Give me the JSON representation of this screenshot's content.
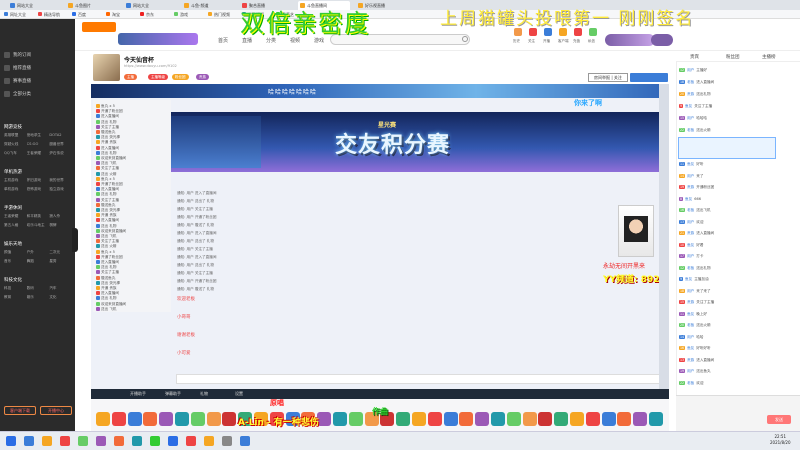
{
  "browser": {
    "tabs": [
      {
        "label": "网站大全",
        "color": "#3b7dd8"
      },
      {
        "label": "斗鱼图片",
        "color": "#f5a623"
      },
      {
        "label": "网站大全",
        "color": "#3b7dd8"
      },
      {
        "label": "斗鱼-频道",
        "color": "#f5a623"
      },
      {
        "label": "聚合直播",
        "color": "#e44"
      },
      {
        "label": "斗鱼直播间",
        "color": "#f5a623"
      },
      {
        "label": "好乐视直播",
        "color": "#f5a623"
      }
    ],
    "bookmarks": [
      {
        "label": "网址大全",
        "color": "#3b7dd8"
      },
      {
        "label": "精选导航",
        "color": "#e44"
      },
      {
        "label": "百度",
        "color": "#2b6de5"
      },
      {
        "label": "淘宝",
        "color": "#f60"
      },
      {
        "label": "京东",
        "color": "#e22"
      },
      {
        "label": "游戏",
        "color": "#6c6"
      },
      {
        "label": "热门视频",
        "color": "#f5a623"
      },
      {
        "label": "优酷视频",
        "color": "#29a"
      },
      {
        "label": "爱奇艺",
        "color": "#3c3"
      }
    ],
    "url": "https://www.douyu.com/9102"
  },
  "banner": {
    "title": "双倍亲密度",
    "subtitle": "上周猫罐头投喂第一 刚刚签名"
  },
  "header": {
    "nav": [
      "首页",
      "直播",
      "分类",
      "视频",
      "游戏",
      "鱼吧"
    ],
    "icons": [
      "历史",
      "关注",
      "开播",
      "客户端",
      "充值",
      "私信"
    ]
  },
  "sidebar": {
    "top_items": [
      "我的订阅",
      "推荐直播",
      "赛事直播",
      "全部分类"
    ],
    "sections": [
      {
        "title": "网游竞技",
        "items": [
          "英雄联盟",
          "绝地求生",
          "DOTA2",
          "穿越火线",
          "CS:GO",
          "魔兽世界",
          "QQ飞车",
          "王者荣耀",
          "炉石传说"
        ]
      },
      {
        "title": "单机热游",
        "items": [
          "主机游戏",
          "怀旧游戏",
          "我的世界",
          "单机游戏",
          "恐怖游戏",
          "独立游戏"
        ]
      },
      {
        "title": "手游休闲",
        "items": [
          "王者荣耀",
          "和平精英",
          "狼人杀",
          "第五人格",
          "欢乐斗地主",
          "棋牌"
        ]
      },
      {
        "title": "娱乐天地",
        "items": [
          "颜值",
          "户外",
          "二次元",
          "音乐",
          "舞蹈",
          "星秀"
        ]
      },
      {
        "title": "科技文化",
        "items": [
          "科技",
          "数码",
          "汽车",
          "教育",
          "娱乐",
          "文化"
        ]
      }
    ],
    "buttons": [
      "客户端下载",
      "开播中心"
    ]
  },
  "anchor": {
    "room_title": "今天仙音杯",
    "tags": [
      "主播",
      "主播等级",
      "粉丝团",
      "贵族"
    ],
    "report": "房间举报 | 关注"
  },
  "video": {
    "top_text": "哈哈哈哈哈哈哈",
    "banner_title": "交友积分赛",
    "banner_sub": "星光赛",
    "corner_text": "你来了啊",
    "yy_label": "永劫无间开黑来",
    "yy_channel": "YY频道: 892",
    "logs": [
      "通知: 用户 进入了直播间",
      "通知: 用户 送出了 礼物",
      "通知: 用户 关注了主播",
      "通知: 用户 开通了粉丝团",
      "通知: 用户 赠送了 礼物",
      "通知: 用户 进入了直播间",
      "通知: 用户 送出了 礼物",
      "通知: 用户 关注了主播",
      "通知: 用户 进入了直播间",
      "通知: 用户 送出了 礼物",
      "通知: 用户 关注了主播",
      "通知: 用户 开通了粉丝团",
      "通知: 用户 赠送了 礼物"
    ],
    "chat_highlights": [
      "欢迎老板",
      "小哥哥",
      "谢谢老板",
      "小可爱"
    ],
    "taskbar": [
      "开播助手",
      "弹幕助手",
      "礼物",
      "设置"
    ]
  },
  "inner_chat": [
    "鱼丸 x 5",
    "开通了粉丝团",
    "进入直播间",
    "送出 礼物",
    "关注了主播",
    "赠送鱼丸",
    "送出 荧光棒",
    "开通 贵族",
    "进入直播间",
    "送出 礼物",
    "欢迎来到直播间",
    "送出 飞机",
    "关注了主播",
    "送出 火箭"
  ],
  "song": {
    "text": "A-Lin - 有一种悲伤",
    "lyric_red": "原唱",
    "lyric_green": "作曲"
  },
  "right_chat": {
    "tabs": [
      "贵宾",
      "粉丝团",
      "主播榜"
    ],
    "rows": [
      {
        "lv": "12",
        "name": "用户",
        "msg": "主播好"
      },
      {
        "lv": "18",
        "name": "老板",
        "msg": "进入直播间"
      },
      {
        "lv": "20",
        "name": "贵族",
        "msg": "送出礼物"
      },
      {
        "lv": "9",
        "name": "鱼友",
        "msg": "关注了主播"
      },
      {
        "lv": "15",
        "name": "用户",
        "msg": "哈哈哈"
      },
      {
        "lv": "22",
        "name": "老板",
        "msg": "送出火箭"
      },
      {
        "lv": "11",
        "name": "鱼友",
        "msg": "好听"
      },
      {
        "lv": "14",
        "name": "用户",
        "msg": "来了"
      },
      {
        "lv": "19",
        "name": "贵族",
        "msg": "开通粉丝团"
      },
      {
        "lv": "8",
        "name": "鱼友",
        "msg": "666"
      },
      {
        "lv": "16",
        "name": "老板",
        "msg": "送出飞机"
      },
      {
        "lv": "13",
        "name": "用户",
        "msg": "欢迎"
      },
      {
        "lv": "21",
        "name": "贵族",
        "msg": "进入直播间"
      },
      {
        "lv": "10",
        "name": "鱼友",
        "msg": "好看"
      },
      {
        "lv": "17",
        "name": "用户",
        "msg": "打卡"
      },
      {
        "lv": "12",
        "name": "老板",
        "msg": "送出礼物"
      },
      {
        "lv": "9",
        "name": "鱼友",
        "msg": "主播加油"
      },
      {
        "lv": "18",
        "name": "用户",
        "msg": "来了来了"
      },
      {
        "lv": "15",
        "name": "贵族",
        "msg": "关注了主播"
      },
      {
        "lv": "11",
        "name": "鱼友",
        "msg": "晚上好"
      },
      {
        "lv": "20",
        "name": "老板",
        "msg": "送出火箭"
      },
      {
        "lv": "14",
        "name": "用户",
        "msg": "哈哈"
      },
      {
        "lv": "16",
        "name": "鱼友",
        "msg": "好听好听"
      },
      {
        "lv": "13",
        "name": "贵族",
        "msg": "进入直播间"
      },
      {
        "lv": "19",
        "name": "用户",
        "msg": "送出鱼丸"
      },
      {
        "lv": "22",
        "name": "老板",
        "msg": "欢迎"
      }
    ],
    "send": "发送"
  },
  "taskbar": {
    "time": "22:51",
    "date": "2021/8/20"
  }
}
